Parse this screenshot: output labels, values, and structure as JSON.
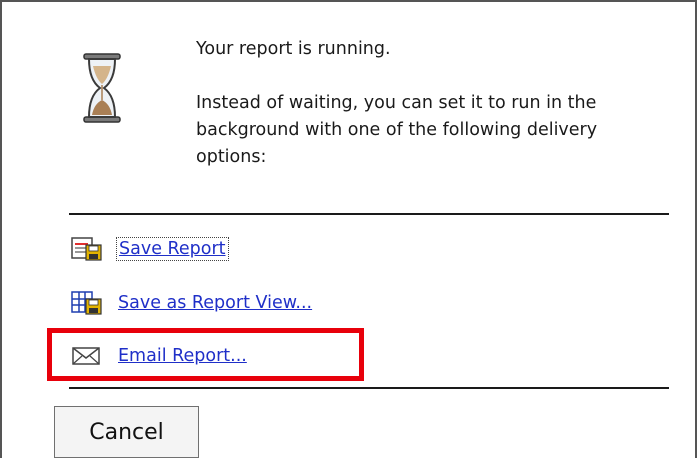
{
  "message": {
    "title": "Your report is running.",
    "body": "Instead of waiting, you can set it to run in the background with one of the following delivery options:"
  },
  "options": [
    {
      "label": "Save Report",
      "icon": "save-report-icon"
    },
    {
      "label": "Save as Report View...",
      "icon": "save-report-view-icon"
    },
    {
      "label": "Email Report...",
      "icon": "envelope-icon"
    }
  ],
  "buttons": {
    "cancel_label": "Cancel"
  },
  "colors": {
    "link": "#1f2fc8",
    "highlight": "#e8000b",
    "text": "#1a1a1a"
  },
  "icons": {
    "status": "hourglass-icon"
  }
}
